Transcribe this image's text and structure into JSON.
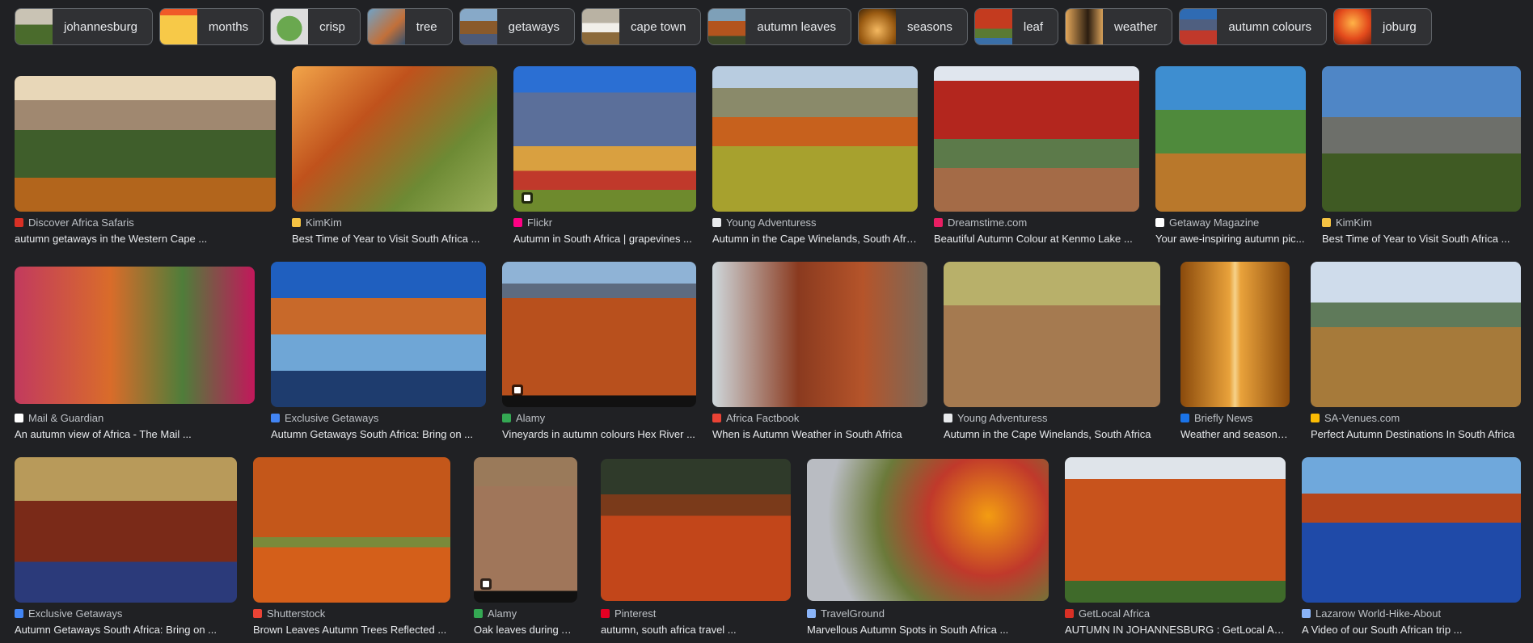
{
  "chips": [
    {
      "label": "johannesburg",
      "thumb": "city-thumb"
    },
    {
      "label": "months",
      "thumb": "calendar-thumb"
    },
    {
      "label": "crisp",
      "thumb": "vegetable-thumb"
    },
    {
      "label": "tree",
      "thumb": "tree-thumb"
    },
    {
      "label": "getaways",
      "thumb": "lodge-thumb"
    },
    {
      "label": "cape town",
      "thumb": "house-thumb"
    },
    {
      "label": "autumn leaves",
      "thumb": "leaves-thumb"
    },
    {
      "label": "seasons",
      "thumb": "path-thumb"
    },
    {
      "label": "leaf",
      "thumb": "leaf-thumb"
    },
    {
      "label": "weather",
      "thumb": "person-thumb"
    },
    {
      "label": "autumn colours",
      "thumb": "mountain-thumb"
    },
    {
      "label": "joburg",
      "thumb": "forest-thumb"
    }
  ],
  "results": [
    {
      "source": "Discover Africa Safaris",
      "title": "autumn getaways in the Western Cape ...",
      "favicon_color": "#d93025"
    },
    {
      "source": "KimKim",
      "title": "Best Time of Year to Visit South Africa ...",
      "favicon_color": "#f6c343"
    },
    {
      "source": "Flickr",
      "title": "Autumn in South Africa | grapevines ...",
      "favicon_color": "#ff0084"
    },
    {
      "source": "Young Adventuress",
      "title": "Autumn in the Cape Winelands, South Africa",
      "favicon_color": "#e8eaed"
    },
    {
      "source": "Dreamstime.com",
      "title": "Beautiful Autumn Colour at Kenmo Lake ...",
      "favicon_color": "#e91e63"
    },
    {
      "source": "Getaway Magazine",
      "title": "Your awe-inspiring autumn pic...",
      "favicon_color": "#ffffff"
    },
    {
      "source": "KimKim",
      "title": "Best Time of Year to Visit South Africa ...",
      "favicon_color": "#f6c343"
    },
    {
      "source": "Mail & Guardian",
      "title": "An autumn view of Africa - The Mail ...",
      "favicon_color": "#ffffff"
    },
    {
      "source": "Exclusive Getaways",
      "title": "Autumn Getaways South Africa: Bring on ...",
      "favicon_color": "#4285f4"
    },
    {
      "source": "Alamy",
      "title": "Vineyards in autumn colours Hex River ...",
      "favicon_color": "#34a853"
    },
    {
      "source": "Africa Factbook",
      "title": "When is Autumn Weather in South Africa",
      "favicon_color": "#ea4335"
    },
    {
      "source": "Young Adventuress",
      "title": "Autumn in the Cape Winelands, South Africa",
      "favicon_color": "#e8eaed"
    },
    {
      "source": "Briefly News",
      "title": "Weather and seasons i...",
      "favicon_color": "#1a73e8"
    },
    {
      "source": "SA-Venues.com",
      "title": "Perfect Autumn Destinations In South Africa",
      "favicon_color": "#fbbc04"
    },
    {
      "source": "Exclusive Getaways",
      "title": "Autumn Getaways South Africa: Bring on ...",
      "favicon_color": "#4285f4"
    },
    {
      "source": "Shutterstock",
      "title": "Brown Leaves Autumn Trees Reflected ...",
      "favicon_color": "#ea4335"
    },
    {
      "source": "Alamy",
      "title": "Oak leaves during Autu...",
      "favicon_color": "#34a853"
    },
    {
      "source": "Pinterest",
      "title": "autumn, south africa travel ...",
      "favicon_color": "#e60023"
    },
    {
      "source": "TravelGround",
      "title": "Marvellous Autumn Spots in South Africa ...",
      "favicon_color": "#8ab4f8"
    },
    {
      "source": "GetLocal Africa",
      "title": "AUTUMN IN JOHANNESBURG : GetLocal Africa",
      "favicon_color": "#d93025"
    },
    {
      "source": "Lazarow World-Hike-About",
      "title": "A Video of our South African trip ...",
      "favicon_color": "#8ab4f8"
    }
  ]
}
